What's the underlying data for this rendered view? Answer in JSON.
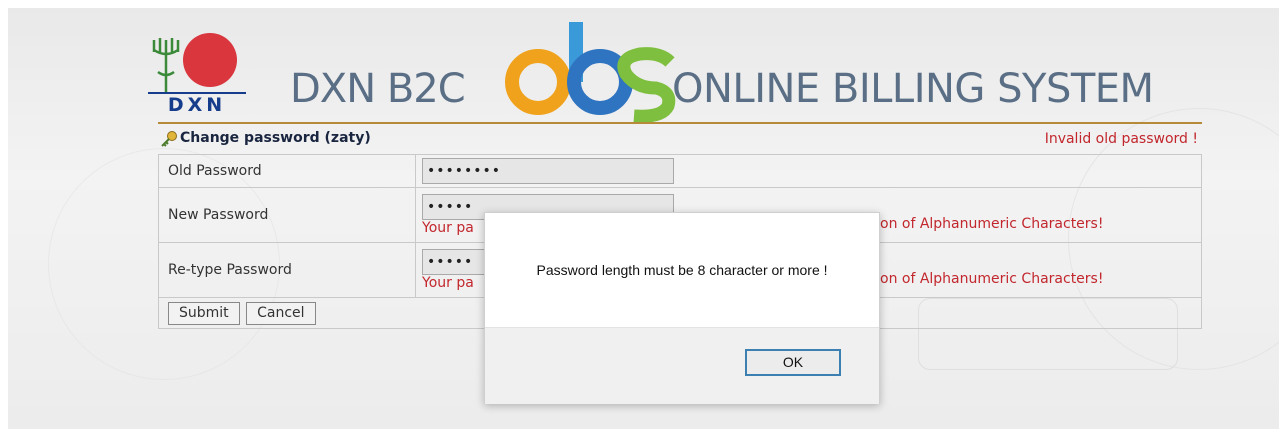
{
  "header": {
    "logo_text": "DXN",
    "brand_left": "DXN B2C",
    "brand_mid": "obs",
    "brand_right": "ONLINE BILLING SYSTEM"
  },
  "panel": {
    "title": "Change password (zaty)",
    "error": "Invalid old password !"
  },
  "form": {
    "old_password": {
      "label": "Old Password",
      "value": "••••••••"
    },
    "new_password": {
      "label": "New Password",
      "value": "•••••",
      "warn_left": "Your pa",
      "warn_right": "on of Alphanumeric Characters!"
    },
    "retype_password": {
      "label": "Re-type Password",
      "value": "•••••",
      "warn_left": "Your pa",
      "warn_right": "on of Alphanumeric Characters!"
    },
    "submit_label": "Submit",
    "cancel_label": "Cancel"
  },
  "dialog": {
    "message": "Password length must be 8 character or more !",
    "ok_label": "OK"
  },
  "colors": {
    "accent_brown": "#b58b3a",
    "error_red": "#c2272d",
    "brand_blue": "#163d8c",
    "ok_border": "#3c7fb1"
  }
}
